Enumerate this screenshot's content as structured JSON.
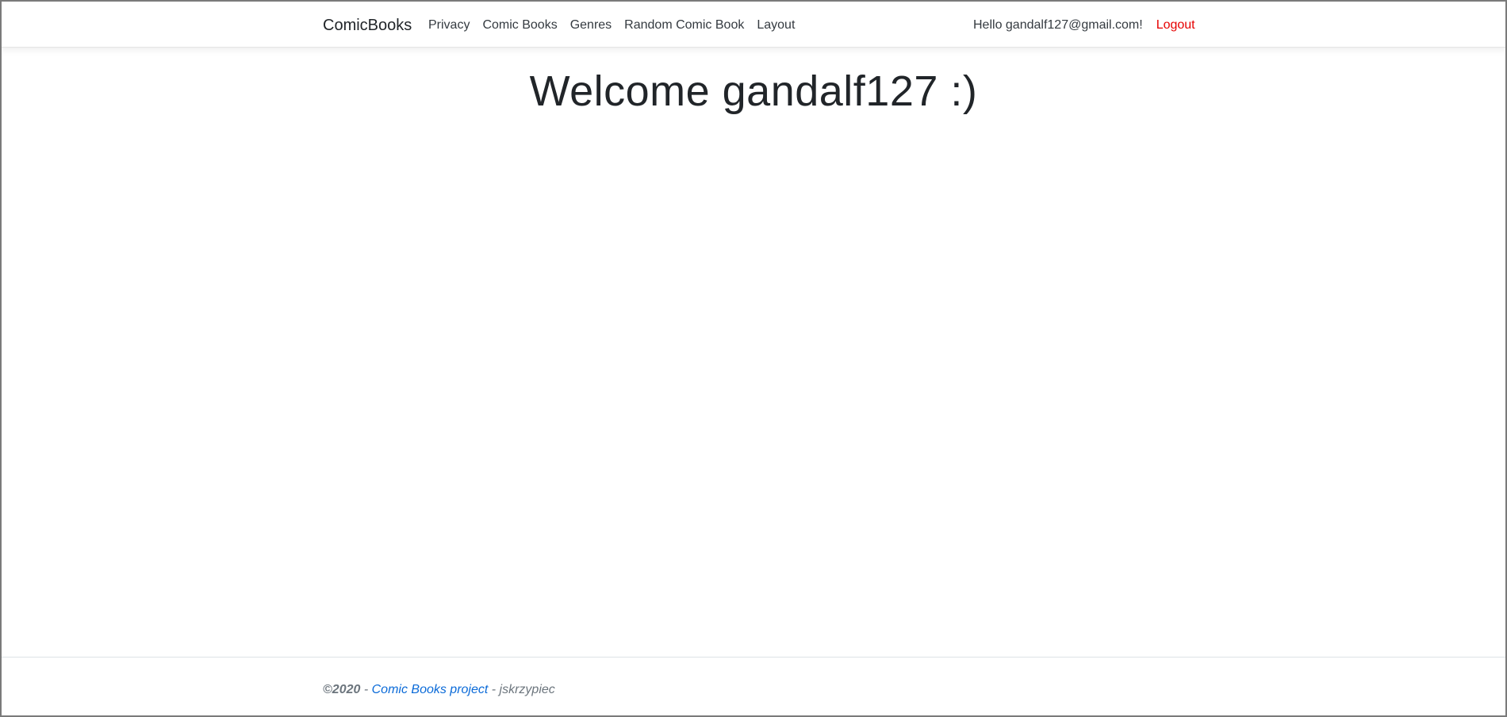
{
  "navbar": {
    "brand": "ComicBooks",
    "links": [
      {
        "label": "Privacy"
      },
      {
        "label": "Comic Books"
      },
      {
        "label": "Genres"
      },
      {
        "label": "Random Comic Book"
      },
      {
        "label": "Layout"
      }
    ],
    "greeting": "Hello gandalf127@gmail.com!",
    "logout_label": "Logout"
  },
  "main": {
    "welcome": "Welcome gandalf127 :)"
  },
  "footer": {
    "copyright": "©2020",
    "sep1": " - ",
    "project_link": "Comic Books project",
    "sep2": " - ",
    "author": "jskrzypiec"
  },
  "colors": {
    "logout": "#e60000",
    "link": "#0a6ad8",
    "muted": "#6c757d",
    "text": "#212529"
  }
}
